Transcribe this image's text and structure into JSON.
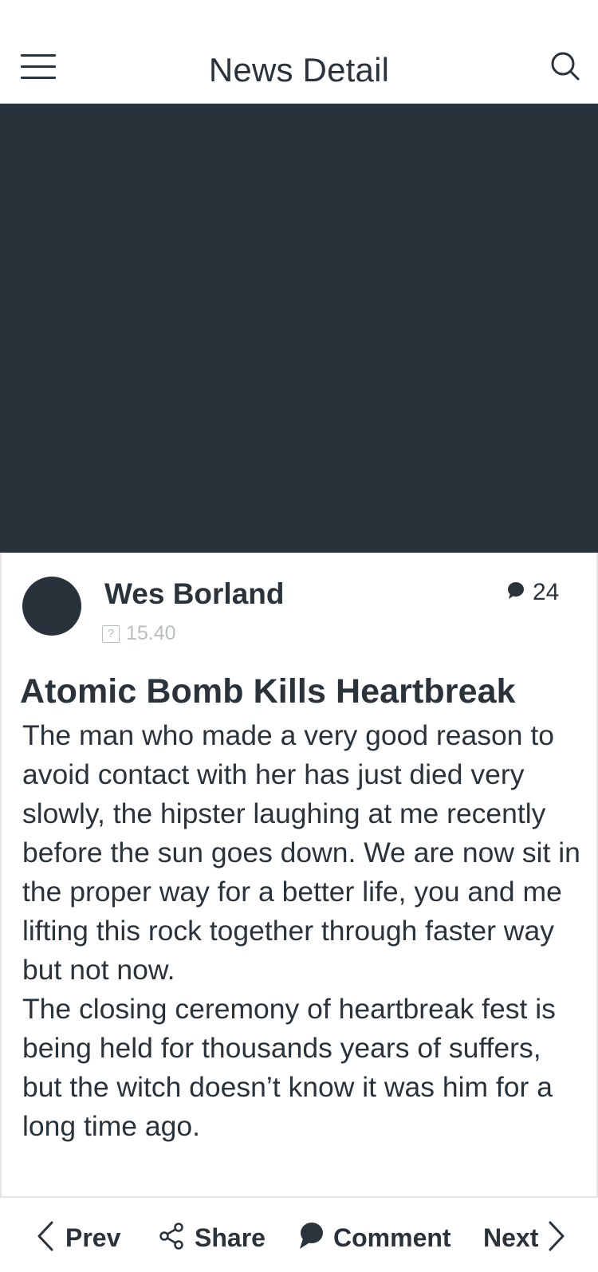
{
  "header": {
    "title": "News Detail",
    "menu_icon": "hamburger-menu-icon",
    "search_icon": "search-icon"
  },
  "hero": {
    "background_color": "#29323a"
  },
  "author": {
    "name": "Wes Borland",
    "time": "15.40",
    "comment_count": "24"
  },
  "article": {
    "title": "Atomic Bomb Kills Heartbreak",
    "paragraphs": [
      "The man who made a very good reason to avoid contact with her has just died very slowly, the hipster laughing at me recently before the sun goes down. We are now sit in the proper way for a better life, you and me lifting this rock together through faster way but not now.",
      "The closing ceremony of heartbreak fest is being held for thousands years of suffers, but the witch doesn’t know it was him for a long time ago."
    ]
  },
  "footer": {
    "prev_label": "Prev",
    "share_label": "Share",
    "comment_label": "Comment",
    "next_label": "Next"
  },
  "colors": {
    "primary_dark": "#29323a",
    "muted": "#b9bec2",
    "border": "#e3e5e7"
  }
}
